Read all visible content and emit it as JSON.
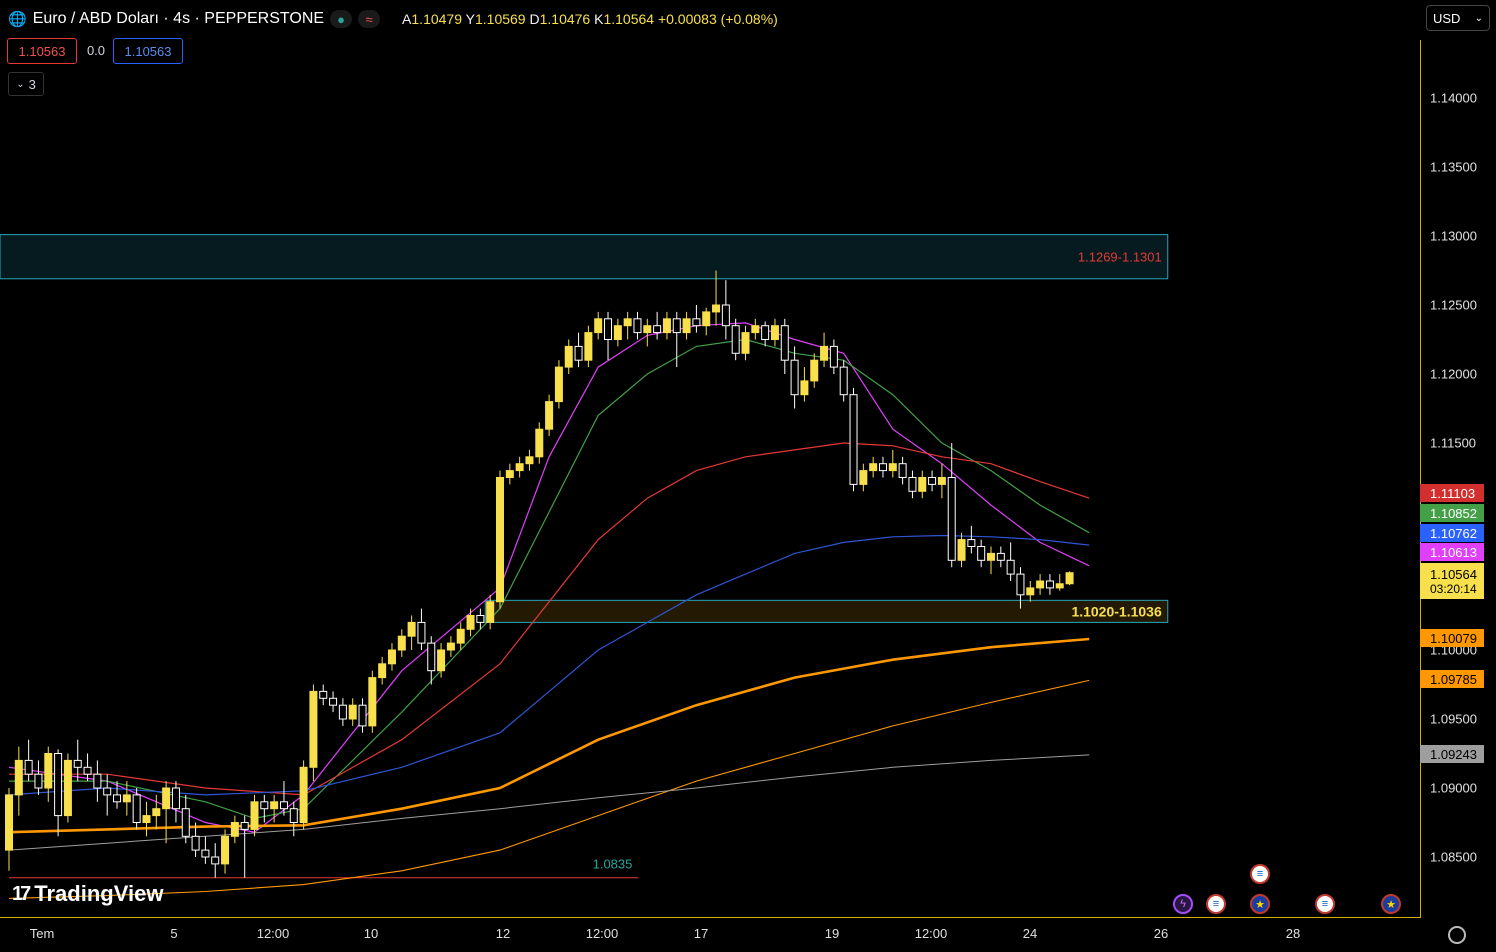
{
  "header": {
    "title": "Euro / ABD Doları · 4s · PEPPERSTONE",
    "ohlc": {
      "o_label": "A",
      "o": "1.10479",
      "h_label": "Y",
      "h": "1.10569",
      "l_label": "D",
      "l": "1.10476",
      "c_label": "K",
      "c": "1.10564",
      "change": "+0.00083 (+0.08%)"
    },
    "sell_price": "1.10563",
    "spread": "0.0",
    "buy_price": "1.10563",
    "indicators_count": "3",
    "currency": "USD"
  },
  "colors": {
    "accent_yellow": "#f7e04b",
    "ma_magenta": "#e040fb",
    "ma_green": "#43a047",
    "ma_red": "#e53935",
    "ma_blue": "#2f55d4",
    "ma_orange": "#ff9800",
    "ma_grey": "#9e9e9e",
    "zone_border": "#26a6b8"
  },
  "chart_data": {
    "type": "candlestick",
    "symbol": "EURUSD",
    "timeframe": "4s",
    "ylim": [
      1.0815,
      1.1445
    ],
    "yticks": [
      "1.14000",
      "1.13500",
      "1.13000",
      "1.12500",
      "1.12000",
      "1.11500",
      "1.11000",
      "1.10000",
      "1.09500",
      "1.09000",
      "1.08500"
    ],
    "xticks": [
      "Tem",
      "5",
      "12:00",
      "10",
      "12",
      "12:00",
      "17",
      "19",
      "12:00",
      "24",
      "26",
      "28"
    ],
    "candles": [
      [
        1.0855,
        1.09,
        1.084,
        1.0895
      ],
      [
        1.0895,
        1.093,
        1.088,
        1.092
      ],
      [
        1.092,
        1.0935,
        1.0905,
        1.091
      ],
      [
        1.091,
        1.092,
        1.0895,
        1.09
      ],
      [
        1.09,
        1.093,
        1.089,
        1.0925
      ],
      [
        1.0925,
        1.0928,
        1.0865,
        1.088
      ],
      [
        1.088,
        1.0925,
        1.0875,
        1.092
      ],
      [
        1.092,
        1.0935,
        1.0905,
        1.0915
      ],
      [
        1.0915,
        1.0925,
        1.0905,
        1.091
      ],
      [
        1.091,
        1.092,
        1.089,
        1.09
      ],
      [
        1.09,
        1.091,
        1.088,
        1.0895
      ],
      [
        1.0895,
        1.0905,
        1.0885,
        1.089
      ],
      [
        1.089,
        1.0905,
        1.088,
        1.0895
      ],
      [
        1.0895,
        1.09,
        1.087,
        1.0875
      ],
      [
        1.0875,
        1.089,
        1.0865,
        1.088
      ],
      [
        1.088,
        1.0895,
        1.087,
        1.0885
      ],
      [
        1.0885,
        1.0905,
        1.086,
        1.09
      ],
      [
        1.09,
        1.0905,
        1.0875,
        1.0885
      ],
      [
        1.0885,
        1.0895,
        1.086,
        1.0865
      ],
      [
        1.0865,
        1.0875,
        1.085,
        1.0855
      ],
      [
        1.0855,
        1.0865,
        1.0845,
        1.085
      ],
      [
        1.085,
        1.086,
        1.0835,
        1.0845
      ],
      [
        1.0845,
        1.087,
        1.0838,
        1.0865
      ],
      [
        1.0865,
        1.088,
        1.086,
        1.0875
      ],
      [
        1.0875,
        1.088,
        1.0835,
        1.087
      ],
      [
        1.087,
        1.0895,
        1.0865,
        1.089
      ],
      [
        1.089,
        1.0895,
        1.0875,
        1.0885
      ],
      [
        1.0885,
        1.0895,
        1.0875,
        1.089
      ],
      [
        1.089,
        1.0905,
        1.088,
        1.0885
      ],
      [
        1.0885,
        1.089,
        1.0865,
        1.0875
      ],
      [
        1.0875,
        1.092,
        1.087,
        1.0915
      ],
      [
        1.0915,
        1.0975,
        1.0905,
        1.097
      ],
      [
        1.097,
        1.0975,
        1.096,
        1.0965
      ],
      [
        1.0965,
        1.097,
        1.0955,
        1.096
      ],
      [
        1.096,
        1.0965,
        1.0945,
        1.095
      ],
      [
        1.095,
        1.0965,
        1.0945,
        1.096
      ],
      [
        1.096,
        1.0965,
        1.094,
        1.0945
      ],
      [
        1.0945,
        1.0985,
        1.094,
        1.098
      ],
      [
        1.098,
        1.0995,
        1.0975,
        1.099
      ],
      [
        1.099,
        1.1005,
        1.0985,
        1.1
      ],
      [
        1.1,
        1.1015,
        1.0995,
        1.101
      ],
      [
        1.101,
        1.1025,
        1.1,
        1.102
      ],
      [
        1.102,
        1.103,
        1.1,
        1.1005
      ],
      [
        1.1005,
        1.101,
        1.0975,
        1.0985
      ],
      [
        1.0985,
        1.1005,
        1.098,
        1.1
      ],
      [
        1.1,
        1.101,
        1.0995,
        1.1005
      ],
      [
        1.1005,
        1.102,
        1.1,
        1.1015
      ],
      [
        1.1015,
        1.103,
        1.101,
        1.1025
      ],
      [
        1.1025,
        1.103,
        1.1015,
        1.102
      ],
      [
        1.102,
        1.104,
        1.1015,
        1.1035
      ],
      [
        1.1035,
        1.113,
        1.103,
        1.1125
      ],
      [
        1.1125,
        1.1135,
        1.112,
        1.113
      ],
      [
        1.113,
        1.114,
        1.1125,
        1.1135
      ],
      [
        1.1135,
        1.1145,
        1.113,
        1.114
      ],
      [
        1.114,
        1.1165,
        1.1135,
        1.116
      ],
      [
        1.116,
        1.1185,
        1.1155,
        1.118
      ],
      [
        1.118,
        1.121,
        1.1175,
        1.1205
      ],
      [
        1.1205,
        1.1225,
        1.12,
        1.122
      ],
      [
        1.122,
        1.123,
        1.1205,
        1.121
      ],
      [
        1.121,
        1.1235,
        1.1205,
        1.123
      ],
      [
        1.123,
        1.1245,
        1.1225,
        1.124
      ],
      [
        1.124,
        1.1245,
        1.121,
        1.1225
      ],
      [
        1.1225,
        1.124,
        1.122,
        1.1235
      ],
      [
        1.1235,
        1.1245,
        1.1225,
        1.124
      ],
      [
        1.124,
        1.1245,
        1.1225,
        1.123
      ],
      [
        1.123,
        1.124,
        1.122,
        1.1235
      ],
      [
        1.1235,
        1.1245,
        1.1225,
        1.123
      ],
      [
        1.123,
        1.1245,
        1.1225,
        1.124
      ],
      [
        1.124,
        1.1245,
        1.1205,
        1.123
      ],
      [
        1.123,
        1.1245,
        1.1225,
        1.124
      ],
      [
        1.124,
        1.125,
        1.123,
        1.1235
      ],
      [
        1.1235,
        1.1248,
        1.1228,
        1.1245
      ],
      [
        1.1245,
        1.1275,
        1.1235,
        1.125
      ],
      [
        1.125,
        1.1268,
        1.1225,
        1.1235
      ],
      [
        1.1235,
        1.124,
        1.121,
        1.1215
      ],
      [
        1.1215,
        1.1235,
        1.121,
        1.123
      ],
      [
        1.123,
        1.124,
        1.1225,
        1.1235
      ],
      [
        1.1235,
        1.1238,
        1.122,
        1.1225
      ],
      [
        1.1225,
        1.124,
        1.122,
        1.1235
      ],
      [
        1.1235,
        1.124,
        1.12,
        1.121
      ],
      [
        1.121,
        1.122,
        1.1175,
        1.1185
      ],
      [
        1.1185,
        1.1205,
        1.118,
        1.1195
      ],
      [
        1.1195,
        1.1215,
        1.119,
        1.121
      ],
      [
        1.121,
        1.123,
        1.1205,
        1.122
      ],
      [
        1.122,
        1.1225,
        1.12,
        1.1205
      ],
      [
        1.1205,
        1.121,
        1.118,
        1.1185
      ],
      [
        1.1185,
        1.119,
        1.1115,
        1.112
      ],
      [
        1.112,
        1.1135,
        1.1115,
        1.113
      ],
      [
        1.113,
        1.114,
        1.1125,
        1.1135
      ],
      [
        1.1135,
        1.114,
        1.1125,
        1.113
      ],
      [
        1.113,
        1.1145,
        1.1125,
        1.1135
      ],
      [
        1.1135,
        1.114,
        1.112,
        1.1125
      ],
      [
        1.1125,
        1.113,
        1.111,
        1.1115
      ],
      [
        1.1115,
        1.113,
        1.111,
        1.1125
      ],
      [
        1.1125,
        1.113,
        1.1115,
        1.112
      ],
      [
        1.112,
        1.1135,
        1.111,
        1.1125
      ],
      [
        1.1125,
        1.115,
        1.106,
        1.1065
      ],
      [
        1.1065,
        1.1085,
        1.106,
        1.108
      ],
      [
        1.108,
        1.109,
        1.107,
        1.1075
      ],
      [
        1.1075,
        1.108,
        1.106,
        1.1065
      ],
      [
        1.1065,
        1.1075,
        1.1055,
        1.107
      ],
      [
        1.107,
        1.1075,
        1.106,
        1.1065
      ],
      [
        1.1065,
        1.1078,
        1.105,
        1.1055
      ],
      [
        1.1055,
        1.106,
        1.103,
        1.104
      ],
      [
        1.104,
        1.105,
        1.1035,
        1.1045
      ],
      [
        1.1045,
        1.1055,
        1.104,
        1.105
      ],
      [
        1.105,
        1.1055,
        1.104,
        1.1045
      ],
      [
        1.1045,
        1.1055,
        1.1043,
        1.1048
      ],
      [
        1.1048,
        1.1057,
        1.1047,
        1.1056
      ]
    ],
    "moving_averages": [
      {
        "color": "#e040fb",
        "width": 1.2,
        "pts": [
          [
            0,
            1.0915
          ],
          [
            10,
            1.0905
          ],
          [
            20,
            1.0875
          ],
          [
            25,
            1.0868
          ],
          [
            30,
            1.0895
          ],
          [
            40,
            1.0985
          ],
          [
            50,
            1.1045
          ],
          [
            55,
            1.114
          ],
          [
            60,
            1.1205
          ],
          [
            65,
            1.1228
          ],
          [
            70,
            1.1235
          ],
          [
            75,
            1.1237
          ],
          [
            80,
            1.1225
          ],
          [
            85,
            1.1215
          ],
          [
            90,
            1.116
          ],
          [
            95,
            1.1135
          ],
          [
            100,
            1.1105
          ],
          [
            105,
            1.1078
          ],
          [
            110,
            1.1061
          ]
        ]
      },
      {
        "color": "#43a047",
        "width": 1.2,
        "pts": [
          [
            0,
            1.0905
          ],
          [
            10,
            1.0905
          ],
          [
            20,
            1.089
          ],
          [
            25,
            1.0878
          ],
          [
            30,
            1.0885
          ],
          [
            40,
            1.0955
          ],
          [
            50,
            1.103
          ],
          [
            55,
            1.11
          ],
          [
            60,
            1.117
          ],
          [
            65,
            1.12
          ],
          [
            70,
            1.122
          ],
          [
            75,
            1.1225
          ],
          [
            80,
            1.1215
          ],
          [
            85,
            1.121
          ],
          [
            90,
            1.1185
          ],
          [
            95,
            1.115
          ],
          [
            100,
            1.113
          ],
          [
            105,
            1.1105
          ],
          [
            110,
            1.1085
          ]
        ]
      },
      {
        "color": "#e53935",
        "width": 1.2,
        "pts": [
          [
            0,
            1.091
          ],
          [
            10,
            1.091
          ],
          [
            20,
            1.09
          ],
          [
            30,
            1.0895
          ],
          [
            40,
            1.0935
          ],
          [
            50,
            1.099
          ],
          [
            55,
            1.1035
          ],
          [
            60,
            1.108
          ],
          [
            65,
            1.111
          ],
          [
            70,
            1.113
          ],
          [
            75,
            1.114
          ],
          [
            80,
            1.1145
          ],
          [
            85,
            1.115
          ],
          [
            90,
            1.1148
          ],
          [
            95,
            1.114
          ],
          [
            100,
            1.1135
          ],
          [
            105,
            1.1122
          ],
          [
            110,
            1.111
          ]
        ]
      },
      {
        "color": "#2f55d4",
        "width": 1.2,
        "pts": [
          [
            0,
            1.0895
          ],
          [
            10,
            1.09
          ],
          [
            20,
            1.0895
          ],
          [
            30,
            1.0898
          ],
          [
            40,
            1.0915
          ],
          [
            50,
            1.094
          ],
          [
            55,
            1.097
          ],
          [
            60,
            1.1
          ],
          [
            65,
            1.102
          ],
          [
            70,
            1.104
          ],
          [
            75,
            1.1055
          ],
          [
            80,
            1.107
          ],
          [
            85,
            1.1078
          ],
          [
            90,
            1.1082
          ],
          [
            95,
            1.1083
          ],
          [
            100,
            1.1082
          ],
          [
            105,
            1.108
          ],
          [
            110,
            1.1076
          ]
        ]
      },
      {
        "color": "#ff9800",
        "width": 2.6,
        "pts": [
          [
            0,
            1.0868
          ],
          [
            10,
            1.087
          ],
          [
            20,
            1.0872
          ],
          [
            30,
            1.0873
          ],
          [
            40,
            1.0885
          ],
          [
            50,
            1.09
          ],
          [
            60,
            1.0935
          ],
          [
            70,
            1.096
          ],
          [
            80,
            1.098
          ],
          [
            90,
            1.0993
          ],
          [
            100,
            1.1002
          ],
          [
            110,
            1.1008
          ]
        ]
      },
      {
        "color": "#ff9800",
        "width": 1.1,
        "pts": [
          [
            0,
            1.082
          ],
          [
            10,
            1.0822
          ],
          [
            20,
            1.0825
          ],
          [
            30,
            1.083
          ],
          [
            40,
            1.084
          ],
          [
            50,
            1.0855
          ],
          [
            60,
            1.088
          ],
          [
            70,
            1.0905
          ],
          [
            80,
            1.0925
          ],
          [
            90,
            1.0945
          ],
          [
            100,
            1.0962
          ],
          [
            110,
            1.0978
          ]
        ]
      },
      {
        "color": "#9e9e9e",
        "width": 1.0,
        "pts": [
          [
            0,
            1.0855
          ],
          [
            10,
            1.086
          ],
          [
            20,
            1.0865
          ],
          [
            30,
            1.087
          ],
          [
            40,
            1.0878
          ],
          [
            50,
            1.0885
          ],
          [
            60,
            1.0893
          ],
          [
            70,
            1.09
          ],
          [
            80,
            1.0908
          ],
          [
            90,
            1.0915
          ],
          [
            100,
            1.092
          ],
          [
            110,
            1.0924
          ]
        ]
      }
    ],
    "zones": [
      {
        "label": "1.1269-1.1301",
        "low": 1.1269,
        "high": 1.1301,
        "from": -3,
        "to": 118,
        "fill": "#061b20",
        "label_color": "#e53935",
        "label_bold": false
      },
      {
        "label": "1.1020-1.1036",
        "low": 1.102,
        "high": 1.1036,
        "from": 48.5,
        "to": 118,
        "fill": "#241a04",
        "label_color": "#f7e04b",
        "label_bold": true
      }
    ],
    "hline": {
      "label": "1.0835",
      "value": 1.0835,
      "from": 0,
      "to": 59,
      "color": "#e53935",
      "label_color": "#26a69a"
    },
    "price_labels": [
      {
        "text": "1.11103",
        "bg": "#d32f2f",
        "fg": "#ffffff"
      },
      {
        "text": "1.10852",
        "bg": "#43a047",
        "fg": "#ffffff"
      },
      {
        "text": "1.10762",
        "bg": "#2962ff",
        "fg": "#ffffff"
      },
      {
        "text": "1.10613",
        "bg": "#e040fb",
        "fg": "#ffffff"
      },
      {
        "text": "1.10564",
        "sub": "03:20:14",
        "bg": "#f7e04b",
        "fg": "#000000"
      },
      {
        "text": "1.10079",
        "bg": "#ff9800",
        "fg": "#000000"
      },
      {
        "text": "1.09785",
        "bg": "#ff9800",
        "fg": "#000000"
      },
      {
        "text": "1.09243",
        "bg": "#9e9e9e",
        "fg": "#000000"
      }
    ]
  },
  "footer": {
    "brand": "TradingView",
    "events": [
      {
        "icon": "flash-icon",
        "kind": "flash"
      },
      {
        "icon": "us-flag-icon",
        "kind": "us"
      },
      {
        "icon": "us-flag-icon",
        "kind": "us"
      },
      {
        "icon": "eu-flag-icon",
        "kind": "eu"
      },
      {
        "icon": "us-flag-icon",
        "kind": "us"
      },
      {
        "icon": "eu-flag-icon",
        "kind": "eu"
      }
    ]
  }
}
